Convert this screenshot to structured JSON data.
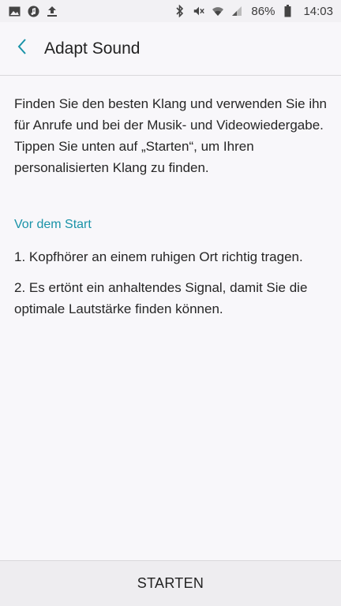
{
  "status_bar": {
    "left_icons": [
      "gallery-icon",
      "music-icon",
      "upload-icon"
    ],
    "right_icons": [
      "bluetooth-icon",
      "mute-icon",
      "wifi-icon",
      "signal-icon"
    ],
    "battery": "86%",
    "time": "14:03"
  },
  "header": {
    "title": "Adapt Sound",
    "back_icon": "chevron-left-icon"
  },
  "main": {
    "intro": "Finden Sie den besten Klang und verwenden Sie ihn für Anrufe und bei der Musik- und Videowiedergabe. Tippen Sie unten auf „Starten“, um Ihren personalisierten Klang zu finden.",
    "section_title": "Vor dem Start",
    "steps": [
      "1. Kopfhörer an einem ruhigen Ort richtig tragen.",
      "2. Es ertönt ein anhaltendes Signal, damit Sie die optimale Lautstärke finden können."
    ]
  },
  "footer": {
    "start_label": "STARTEN"
  },
  "colors": {
    "accent": "#1a93a8",
    "background": "#f8f7fa"
  }
}
